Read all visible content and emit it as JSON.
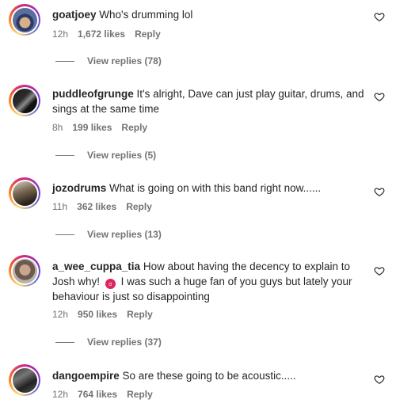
{
  "comments": [
    {
      "username": "goatjoey",
      "text": "Who's drumming lol",
      "time": "12h",
      "likes": "1,672 likes",
      "reply_label": "Reply",
      "view_replies": "View replies (78)"
    },
    {
      "username": "puddleofgrunge",
      "text": "It's alright, Dave can just play guitar, drums, and sings at the same time",
      "time": "8h",
      "likes": "199 likes",
      "reply_label": "Reply",
      "view_replies": "View replies (5)"
    },
    {
      "username": "jozodrums",
      "text": "What is going on with this band right now......",
      "time": "11h",
      "likes": "362 likes",
      "reply_label": "Reply",
      "view_replies": "View replies (13)"
    },
    {
      "username": "a_wee_cuppa_tia",
      "text_before_emoji": "How about having the decency to explain to Josh why!",
      "emoji_icon": "angry-face-emoji",
      "text_after_emoji": "I was such a huge fan of you guys but lately your behaviour is just so disappointing",
      "time": "12h",
      "likes": "950 likes",
      "reply_label": "Reply",
      "view_replies": "View replies (37)"
    },
    {
      "username": "dangoempire",
      "text": "So are these going to be acoustic.....",
      "time": "12h",
      "likes": "764 likes",
      "reply_label": "Reply"
    }
  ],
  "icons": {
    "like": "heart-icon",
    "emoji": "angry-face-emoji"
  },
  "colors": {
    "text": "#262626",
    "secondary": "#737373",
    "emoji": "#e0245e"
  }
}
